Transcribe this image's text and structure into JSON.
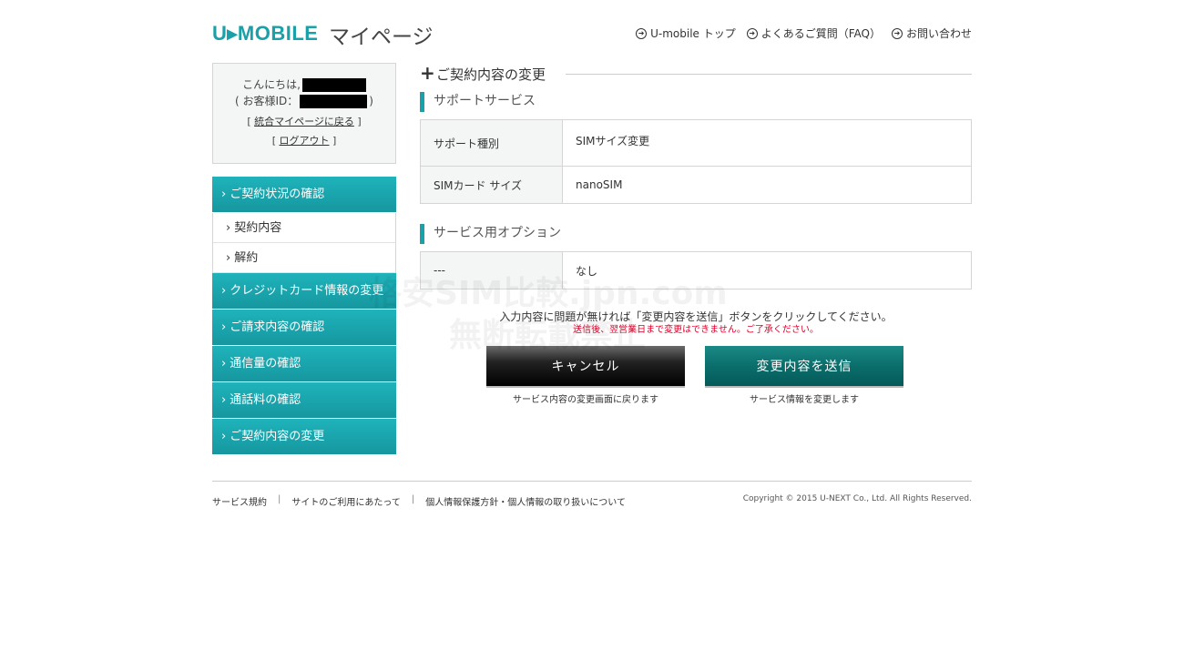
{
  "header": {
    "logo": "U▸MOBILE",
    "title": "マイページ",
    "links": [
      {
        "label": "U-mobile トップ"
      },
      {
        "label": "よくあるご質問（FAQ）"
      },
      {
        "label": "お問い合わせ"
      }
    ]
  },
  "sidebar": {
    "greeting": "こんにちは,",
    "customer_id_label": "( お客様ID：",
    "customer_id_close": ")",
    "portal_link": "統合マイページに戻る",
    "logout_link": "ログアウト",
    "menu": [
      {
        "label": "ご契約状況の確認",
        "type": "main"
      },
      {
        "label": "契約内容",
        "type": "sub"
      },
      {
        "label": "解約",
        "type": "sub"
      },
      {
        "label": "クレジットカード情報の変更",
        "type": "main"
      },
      {
        "label": "ご請求内容の確認",
        "type": "main"
      },
      {
        "label": "通信量の確認",
        "type": "main"
      },
      {
        "label": "通話料の確認",
        "type": "main"
      },
      {
        "label": "ご契約内容の変更",
        "type": "main"
      }
    ]
  },
  "main": {
    "page_title": "ご契約内容の変更",
    "support_section": {
      "heading": "サポートサービス",
      "rows": [
        {
          "label": "サポート種別",
          "value": "SIMサイズ変更"
        },
        {
          "label": "SIMカード サイズ",
          "value": "nanoSIM"
        }
      ]
    },
    "option_section": {
      "heading": "サービス用オプション",
      "rows": [
        {
          "label": "---",
          "value": "なし"
        }
      ]
    },
    "notice_main": "入力内容に問題が無ければ「変更内容を送信」ボタンをクリックしてください。",
    "notice_warning": "送信後、翌営業日まで変更はできません。ご了承ください。",
    "cancel_button": "キャンセル",
    "cancel_caption": "サービス内容の変更画面に戻ります",
    "submit_button": "変更内容を送信",
    "submit_caption": "サービス情報を変更します"
  },
  "footer": {
    "links": [
      "サービス規約",
      "サイトのご利用にあたって",
      "個人情報保護方針・個人情報の取り扱いについて"
    ],
    "copyright": "Copyright © 2015 U-NEXT Co., Ltd. All Rights Reserved."
  },
  "watermark": {
    "line1": "格安SIM比較.jpn.com",
    "line2": "無断転載禁止"
  },
  "colors": {
    "accent": "#1aa0a8",
    "warning": "#e0002a"
  }
}
